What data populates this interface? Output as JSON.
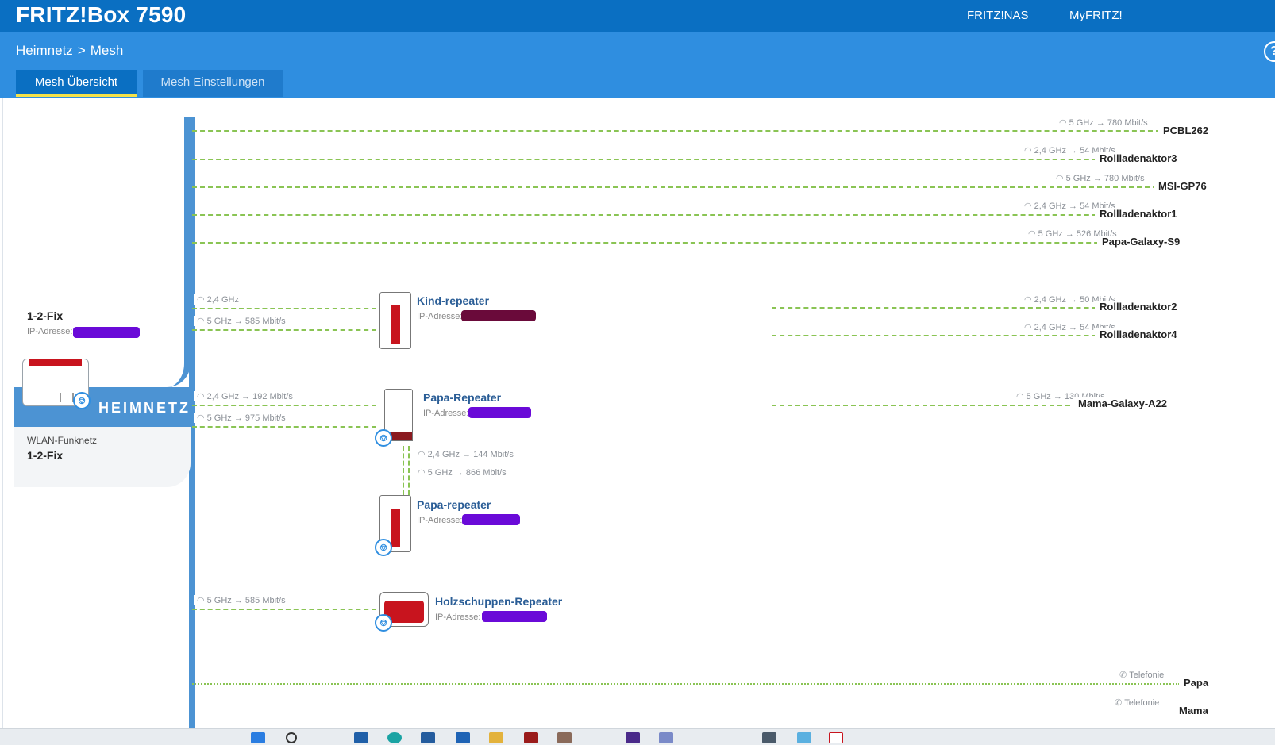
{
  "app": {
    "title": "FRITZ!Box 7590"
  },
  "topnav": {
    "nas": "FRITZ!NAS",
    "myfritz": "MyFRITZ!"
  },
  "breadcrumb": {
    "parent": "Heimnetz",
    "separator": ">",
    "current": "Mesh"
  },
  "tabs": [
    {
      "label": "Mesh Übersicht",
      "active": true
    },
    {
      "label": "Mesh Einstellungen",
      "active": false
    }
  ],
  "help": {
    "icon": "?"
  },
  "router": {
    "name": "1-2-Fix",
    "ip_label": "IP-Adresse:",
    "network_label": "HEIMNETZ",
    "wlan_label": "WLAN-Funknetz",
    "wlan_name": "1-2-Fix"
  },
  "direct_clients": [
    {
      "name": "PCBL262",
      "band": "5 GHz",
      "rate": "780 Mbit/s"
    },
    {
      "name": "Rollladenaktor3",
      "band": "2,4 GHz",
      "rate": "54 Mbit/s"
    },
    {
      "name": "MSI-GP76",
      "band": "5 GHz",
      "rate": "780 Mbit/s"
    },
    {
      "name": "Rollladenaktor1",
      "band": "2,4 GHz",
      "rate": "54 Mbit/s"
    },
    {
      "name": "Papa-Galaxy-S9",
      "band": "5 GHz",
      "rate": "526 Mbit/s"
    }
  ],
  "repeaters": [
    {
      "name": "Kind-repeater",
      "ip_label": "IP-Adresse:",
      "uplinks": [
        {
          "band": "2,4 GHz",
          "rate": ""
        },
        {
          "band": "5 GHz",
          "rate": "585 Mbit/s"
        }
      ],
      "clients": [
        {
          "name": "Rollladenaktor2",
          "band": "2,4 GHz",
          "rate": "50 Mbit/s"
        },
        {
          "name": "Rollladenaktor4",
          "band": "2,4 GHz",
          "rate": "54 Mbit/s"
        }
      ]
    },
    {
      "name": "Papa-Repeater",
      "ip_label": "IP-Adresse:",
      "uplinks": [
        {
          "band": "2,4 GHz",
          "rate": "192 Mbit/s"
        },
        {
          "band": "5 GHz",
          "rate": "975 Mbit/s"
        }
      ],
      "clients": [
        {
          "name": "Mama-Galaxy-A22",
          "band": "5 GHz",
          "rate": "130 Mbit/s"
        }
      ]
    },
    {
      "name": "Papa-repeater",
      "ip_label": "IP-Adresse:",
      "uplinks": [
        {
          "band": "2,4 GHz",
          "rate": "144 Mbit/s"
        },
        {
          "band": "5 GHz",
          "rate": "866 Mbit/s"
        }
      ],
      "clients": []
    },
    {
      "name": "Holzschuppen-Repeater",
      "ip_label": "IP-Adresse:",
      "uplinks": [
        {
          "band": "5 GHz",
          "rate": "585 Mbit/s"
        }
      ],
      "clients": []
    }
  ],
  "telephony": [
    {
      "name": "Papa",
      "type": "Telefonie"
    },
    {
      "name": "Mama",
      "type": "Telefonie"
    }
  ],
  "colors": {
    "topbar": "#0a6fc2",
    "subbar": "#2f8ee0",
    "link": "#8ac454",
    "trunk": "#4c93d3",
    "device_red": "#c8141e",
    "redaction": "#6a0ad8"
  },
  "arrow": "→"
}
